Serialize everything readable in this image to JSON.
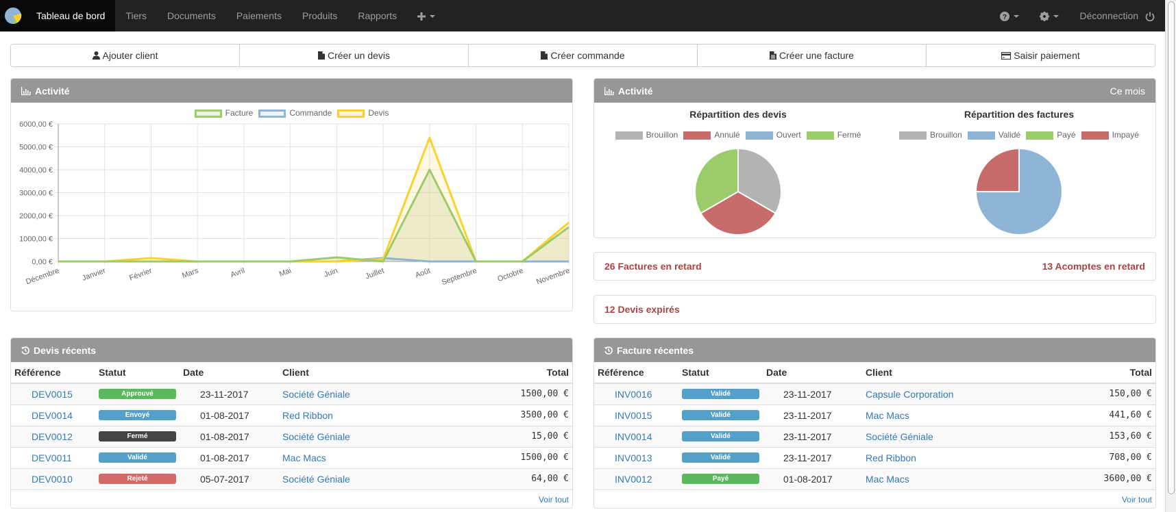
{
  "nav": {
    "brand_icon": "pie-logo-icon",
    "items": [
      {
        "label": "Tableau de bord",
        "active": true
      },
      {
        "label": "Tiers"
      },
      {
        "label": "Documents"
      },
      {
        "label": "Paiements"
      },
      {
        "label": "Produits"
      },
      {
        "label": "Rapports"
      }
    ],
    "plus_icon": "plus-icon",
    "help_icon": "question-circle-icon",
    "settings_icon": "gear-icon",
    "logout_label": "Déconnection",
    "logout_icon": "power-icon"
  },
  "quick_actions": [
    {
      "label": "Ajouter client",
      "icon": "user-icon"
    },
    {
      "label": "Créer un devis",
      "icon": "file-icon"
    },
    {
      "label": "Créer commande",
      "icon": "file-icon"
    },
    {
      "label": "Créer une facture",
      "icon": "file-text-icon"
    },
    {
      "label": "Saisir paiement",
      "icon": "credit-card-icon"
    }
  ],
  "activity_chart": {
    "title": "Activité",
    "icon": "bar-chart-icon"
  },
  "chart_data": [
    {
      "type": "line",
      "title": "Activité",
      "categories": [
        "Décembre",
        "Janvier",
        "Février",
        "Mars",
        "Avril",
        "Mai",
        "Juin",
        "Juillet",
        "Août",
        "Septembre",
        "Octobre",
        "Novembre"
      ],
      "series": [
        {
          "name": "Facture",
          "color": "#9ccc6a",
          "values": [
            0,
            0,
            0,
            0,
            0,
            0,
            180,
            0,
            4000,
            0,
            0,
            1500
          ]
        },
        {
          "name": "Commande",
          "color": "#8fb5d6",
          "values": [
            0,
            0,
            0,
            0,
            0,
            0,
            0,
            150,
            0,
            0,
            0,
            0
          ]
        },
        {
          "name": "Devis",
          "color": "#fdd02c",
          "values": [
            0,
            0,
            150,
            0,
            0,
            0,
            0,
            100,
            5400,
            0,
            0,
            1700
          ]
        }
      ],
      "yticks": [
        "0,00 €",
        "1000,00 €",
        "2000,00 €",
        "3000,00 €",
        "4000,00 €",
        "5000,00 €",
        "6000,00 €"
      ],
      "ylim": [
        0,
        6000
      ],
      "xlabel": "",
      "ylabel": "",
      "grid": true,
      "legend": "top-center"
    },
    {
      "type": "pie",
      "title": "Répartition des devis",
      "labels": [
        "Brouillon",
        "Annulé",
        "Ouvert",
        "Fermé"
      ],
      "colors": [
        "#b3b3b3",
        "#c86b6b",
        "#8fb5d6",
        "#9ccc6a"
      ],
      "values": [
        1,
        1,
        0,
        1
      ],
      "legend": "top"
    },
    {
      "type": "pie",
      "title": "Répartition des factures",
      "labels": [
        "Brouillon",
        "Validé",
        "Payé",
        "Impayé"
      ],
      "colors": [
        "#b3b3b3",
        "#8fb5d6",
        "#9ccc6a",
        "#c86b6b"
      ],
      "values": [
        0,
        3,
        0,
        1
      ],
      "legend": "top"
    }
  ],
  "activity_pies": {
    "title": "Activité",
    "icon": "bar-chart-icon",
    "period": "Ce mois"
  },
  "alerts": {
    "late_invoices": "26 Factures en retard",
    "late_deposits": "13 Acomptes en retard",
    "expired_quotes": "12 Devis expirés"
  },
  "recent_quotes": {
    "title": "Devis récents",
    "icon": "history-icon",
    "columns": [
      "Référence",
      "Statut",
      "Date",
      "Client",
      "Total"
    ],
    "rows": [
      {
        "ref": "DEV0015",
        "status": "Approuvé",
        "status_color": "#5cb85c",
        "date": "23-11-2017",
        "client": "Société Géniale",
        "total": "1500,00 €"
      },
      {
        "ref": "DEV0014",
        "status": "Envoyé",
        "status_color": "#55a0c9",
        "date": "01-08-2017",
        "client": "Red Ribbon",
        "total": "3500,00 €"
      },
      {
        "ref": "DEV0012",
        "status": "Fermé",
        "status_color": "#444444",
        "date": "01-08-2017",
        "client": "Société Géniale",
        "total": "15,00 €"
      },
      {
        "ref": "DEV0011",
        "status": "Validé",
        "status_color": "#55a0c9",
        "date": "01-08-2017",
        "client": "Mac Macs",
        "total": "1500,00 €"
      },
      {
        "ref": "DEV0010",
        "status": "Rejeté",
        "status_color": "#d26a6a",
        "date": "05-07-2017",
        "client": "Société Géniale",
        "total": "64,00 €"
      }
    ],
    "see_all": "Voir tout"
  },
  "recent_invoices": {
    "title": "Facture récentes",
    "icon": "history-icon",
    "columns": [
      "Référence",
      "Statut",
      "Date",
      "Client",
      "Total"
    ],
    "rows": [
      {
        "ref": "INV0016",
        "status": "Validé",
        "status_color": "#55a0c9",
        "date": "23-11-2017",
        "client": "Capsule Corporation",
        "total": "150,00 €"
      },
      {
        "ref": "INV0015",
        "status": "Validé",
        "status_color": "#55a0c9",
        "date": "23-11-2017",
        "client": "Mac Macs",
        "total": "441,60 €"
      },
      {
        "ref": "INV0014",
        "status": "Validé",
        "status_color": "#55a0c9",
        "date": "23-11-2017",
        "client": "Société Géniale",
        "total": "153,60 €"
      },
      {
        "ref": "INV0013",
        "status": "Validé",
        "status_color": "#55a0c9",
        "date": "23-11-2017",
        "client": "Red Ribbon",
        "total": "708,00 €"
      },
      {
        "ref": "INV0012",
        "status": "Payé",
        "status_color": "#5cb85c",
        "date": "01-08-2017",
        "client": "Mac Macs",
        "total": "3600,00 €"
      }
    ],
    "see_all": "Voir tout"
  }
}
